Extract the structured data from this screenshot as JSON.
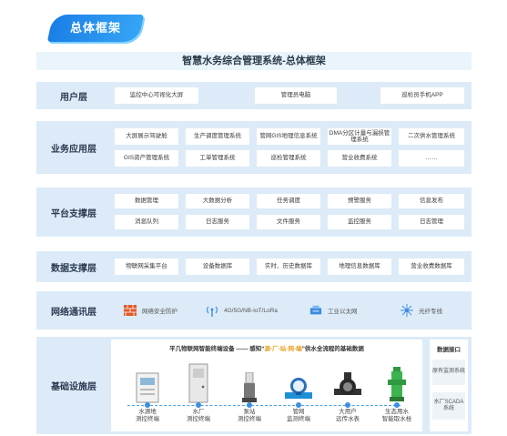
{
  "tag_label": "总体框架",
  "tag_arrows": "›››",
  "title": "智慧水务综合管理系统-总体框架",
  "layers": {
    "user": {
      "label": "用户层",
      "items": [
        "监控中心可视化大屏",
        "管理员电脑",
        "巡检员手机APP"
      ]
    },
    "business": {
      "label": "业务应用层",
      "items": [
        "大屏展示驾驶舱",
        "生产调度管理系统",
        "管网GIS地理信息系统",
        "DMA分区计量与漏损管理系统",
        "二次供水管理系统",
        "GIS资产管理系统",
        "工单管理系统",
        "巡检管理系统",
        "营业收费系统",
        "……"
      ]
    },
    "platform": {
      "label": "平台支撑层",
      "items": [
        "数据管理",
        "大数据分析",
        "任务调度",
        "预警服务",
        "信息发布",
        "消息队列",
        "日志服务",
        "文件服务",
        "监控服务",
        "日志管理"
      ]
    },
    "data": {
      "label": "数据支撑层",
      "items": [
        "物联网采集平台",
        "设备数据库",
        "实时、历史数据库",
        "地理信息数据库",
        "营业收费数据库"
      ]
    },
    "network": {
      "label": "网络通讯层",
      "items": [
        {
          "icon": "firewall-icon",
          "label": "网络安全防护"
        },
        {
          "icon": "signal-icon",
          "label": "4G/5G/NB-IoT/LoRa"
        },
        {
          "icon": "ethernet-icon",
          "label": "工业以太网"
        },
        {
          "icon": "network-hub-icon",
          "label": "光纤专线"
        }
      ]
    },
    "infra": {
      "label": "基础设施层",
      "head_prefix": "平几物联网智能终端设备 —— 感知“",
      "head_highlight": "源-厂-站-网-端",
      "head_suffix": "”供水全流程的基础数据",
      "devices": [
        {
          "icon": "cabinet-icon",
          "line1": "水源地",
          "line2": "测控终端"
        },
        {
          "icon": "control-cabinet-icon",
          "line1": "水厂",
          "line2": "测控终端"
        },
        {
          "icon": "pump-station-icon",
          "line1": "泵站",
          "line2": "测控终端"
        },
        {
          "icon": "pipe-meter-icon",
          "line1": "管网",
          "line2": "监测终端"
        },
        {
          "icon": "water-meter-icon",
          "line1": "大用户",
          "line2": "远传水表"
        },
        {
          "icon": "hydrant-icon",
          "line1": "生态用水",
          "line2": "智能取水栓"
        }
      ],
      "interface_title": "数据接口",
      "interface_items": [
        "原有监测系统",
        "水厂SCADA系统"
      ]
    }
  },
  "colors": {
    "accent": "#1a7fe6",
    "layer_bg": "#dcebf7",
    "title_bg": "#e9f4fb",
    "highlight": "#e8a020"
  }
}
